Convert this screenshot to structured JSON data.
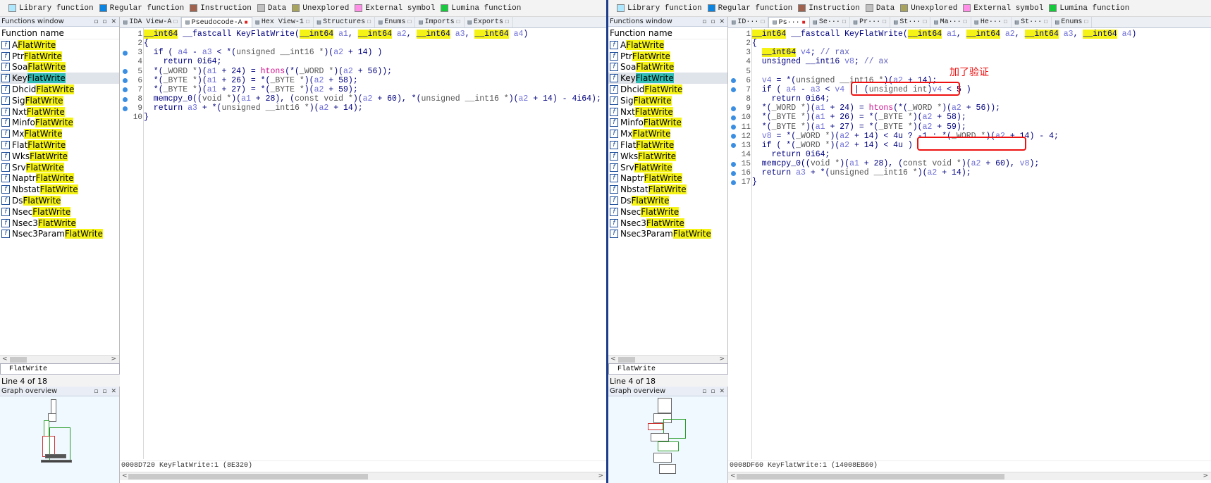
{
  "legend": [
    {
      "label": "Library function",
      "color": "#aee8ff"
    },
    {
      "label": "Regular function",
      "color": "#0a84e0"
    },
    {
      "label": "Instruction",
      "color": "#a0624c"
    },
    {
      "label": "Data",
      "color": "#c0c0c0"
    },
    {
      "label": "Unexplored",
      "color": "#a7a35d"
    },
    {
      "label": "External symbol",
      "color": "#ff8ee7"
    },
    {
      "label": "Lumina function",
      "color": "#17c93c"
    }
  ],
  "functions_window": {
    "title": "Functions window",
    "column": "Function name",
    "search_term": "FlatWrite",
    "items": [
      {
        "prefix": "A",
        "suffix": "FlatWrite"
      },
      {
        "prefix": "Ptr",
        "suffix": "FlatWrite"
      },
      {
        "prefix": "Soa",
        "suffix": "FlatWrite"
      },
      {
        "prefix": "Key",
        "suffix": "FlatWrite"
      },
      {
        "prefix": "Dhcid",
        "suffix": "FlatWrite"
      },
      {
        "prefix": "Sig",
        "suffix": "FlatWrite"
      },
      {
        "prefix": "Nxt",
        "suffix": "FlatWrite"
      },
      {
        "prefix": "Minfo",
        "suffix": "FlatWrite"
      },
      {
        "prefix": "Mx",
        "suffix": "FlatWrite"
      },
      {
        "prefix": "Flat",
        "suffix": "FlatWrite"
      },
      {
        "prefix": "Wks",
        "suffix": "FlatWrite"
      },
      {
        "prefix": "Srv",
        "suffix": "FlatWrite"
      },
      {
        "prefix": "Naptr",
        "suffix": "FlatWrite"
      },
      {
        "prefix": "Nbstat",
        "suffix": "FlatWrite"
      },
      {
        "prefix": "Ds",
        "suffix": "FlatWrite"
      },
      {
        "prefix": "Nsec",
        "suffix": "FlatWrite"
      },
      {
        "prefix": "Nsec3",
        "suffix": "FlatWrite"
      },
      {
        "prefix": "Nsec3Param",
        "suffix": "FlatWrite"
      }
    ],
    "line_status": "Line 4 of 18"
  },
  "graph_overview": {
    "title": "Graph overview"
  },
  "left": {
    "tabs": [
      "IDA View-A",
      "Pseudocode-A",
      "Hex View-1",
      "Structures",
      "Enums",
      "Imports",
      "Exports"
    ],
    "status": "0008D720 KeyFlatWrite:1 (8E320)",
    "lines": [
      "__int64 __fastcall KeyFlatWrite(__int64 a1, __int64 a2, __int64 a3, __int64 a4)",
      "{",
      "  if ( a4 - a3 < *(unsigned __int16 *)(a2 + 14) )",
      "    return 0i64;",
      "  *(_WORD *)(a1 + 24) = htons(*(_WORD *)(a2 + 56));",
      "  *(_BYTE *)(a1 + 26) = *(_BYTE *)(a2 + 58);",
      "  *(_BYTE *)(a1 + 27) = *(_BYTE *)(a2 + 59);",
      "  memcpy_0((void *)(a1 + 28), (const void *)(a2 + 60), *(unsigned __int16 *)(a2 + 14) - 4i64);",
      "  return a3 + *(unsigned __int16 *)(a2 + 14);",
      "}"
    ]
  },
  "right": {
    "tabs": [
      "ID···",
      "Ps···",
      "Se···",
      "Pr···",
      "St···",
      "Ma···",
      "He···",
      "St···",
      "Enums"
    ],
    "status": "0008DF60 KeyFlatWrite:1 (14008EB60)",
    "annotation": "加了验证",
    "lines": [
      "__int64 __fastcall KeyFlatWrite(__int64 a1, __int64 a2, __int64 a3, __int64 a4)",
      "{",
      "  __int64 v4; // rax",
      "  unsigned __int16 v8; // ax",
      "",
      "  v4 = *(unsigned __int16 *)(a2 + 14);",
      "  if ( a4 - a3 < v4 || (unsigned int)v4 < 5 )",
      "    return 0i64;",
      "  *(_WORD *)(a1 + 24) = htons(*(_WORD *)(a2 + 56));",
      "  *(_BYTE *)(a1 + 26) = *(_BYTE *)(a2 + 58);",
      "  *(_BYTE *)(a1 + 27) = *(_BYTE *)(a2 + 59);",
      "  v8 = *(_WORD *)(a2 + 14) < 4u ? -1 : *(_WORD *)(a2 + 14) - 4;",
      "  if ( *(_WORD *)(a2 + 14) < 4u )",
      "    return 0i64;",
      "  memcpy_0((void *)(a1 + 28), (const void *)(a2 + 60), v8);",
      "  return a3 + *(unsigned __int16 *)(a2 + 14);",
      "}"
    ]
  }
}
